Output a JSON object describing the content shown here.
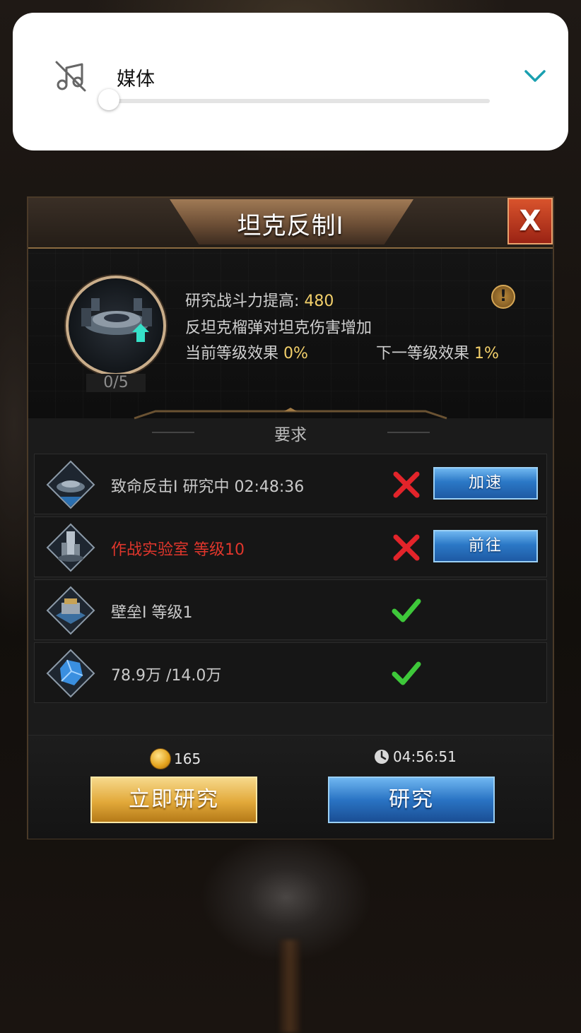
{
  "volume_panel": {
    "label": "媒体",
    "level_percent": 0,
    "icons": {
      "muted": "music-off-icon",
      "expand": "chevron-down-icon"
    },
    "accent_color": "#1aa0b0"
  },
  "dialog": {
    "title": "坦克反制I",
    "close_label": "X",
    "tech": {
      "level": "0/5",
      "power_label": "研究战斗力提高:",
      "power_value": "480",
      "description": "反坦克榴弹对坦克伤害增加",
      "current_label": "当前等级效果",
      "current_value": "0%",
      "next_label": "下一等级效果",
      "next_value": "1%",
      "info_icon": "!"
    },
    "requirements_title": "要求",
    "requirements": [
      {
        "text": "致命反击I 研究中 02:48:36",
        "met": false,
        "button": "加速",
        "icon": "tech-icon"
      },
      {
        "text": "作战实验室 等级10",
        "met": false,
        "button": "前往",
        "icon": "lab-building-icon"
      },
      {
        "text": "壁垒I 等级1",
        "met": true,
        "icon": "fortress-building-icon"
      },
      {
        "text": "78.9万 /14.0万",
        "met": true,
        "icon": "crystal-resource-icon"
      }
    ],
    "footer": {
      "gold_cost": "165",
      "time_cost": "04:56:51",
      "instant_button": "立即研究",
      "research_button": "研究"
    }
  },
  "colors": {
    "gold": "#f2cf6a",
    "error_red": "#e0362c",
    "ok_green": "#3ec83a",
    "button_blue": "#2b78c6"
  }
}
